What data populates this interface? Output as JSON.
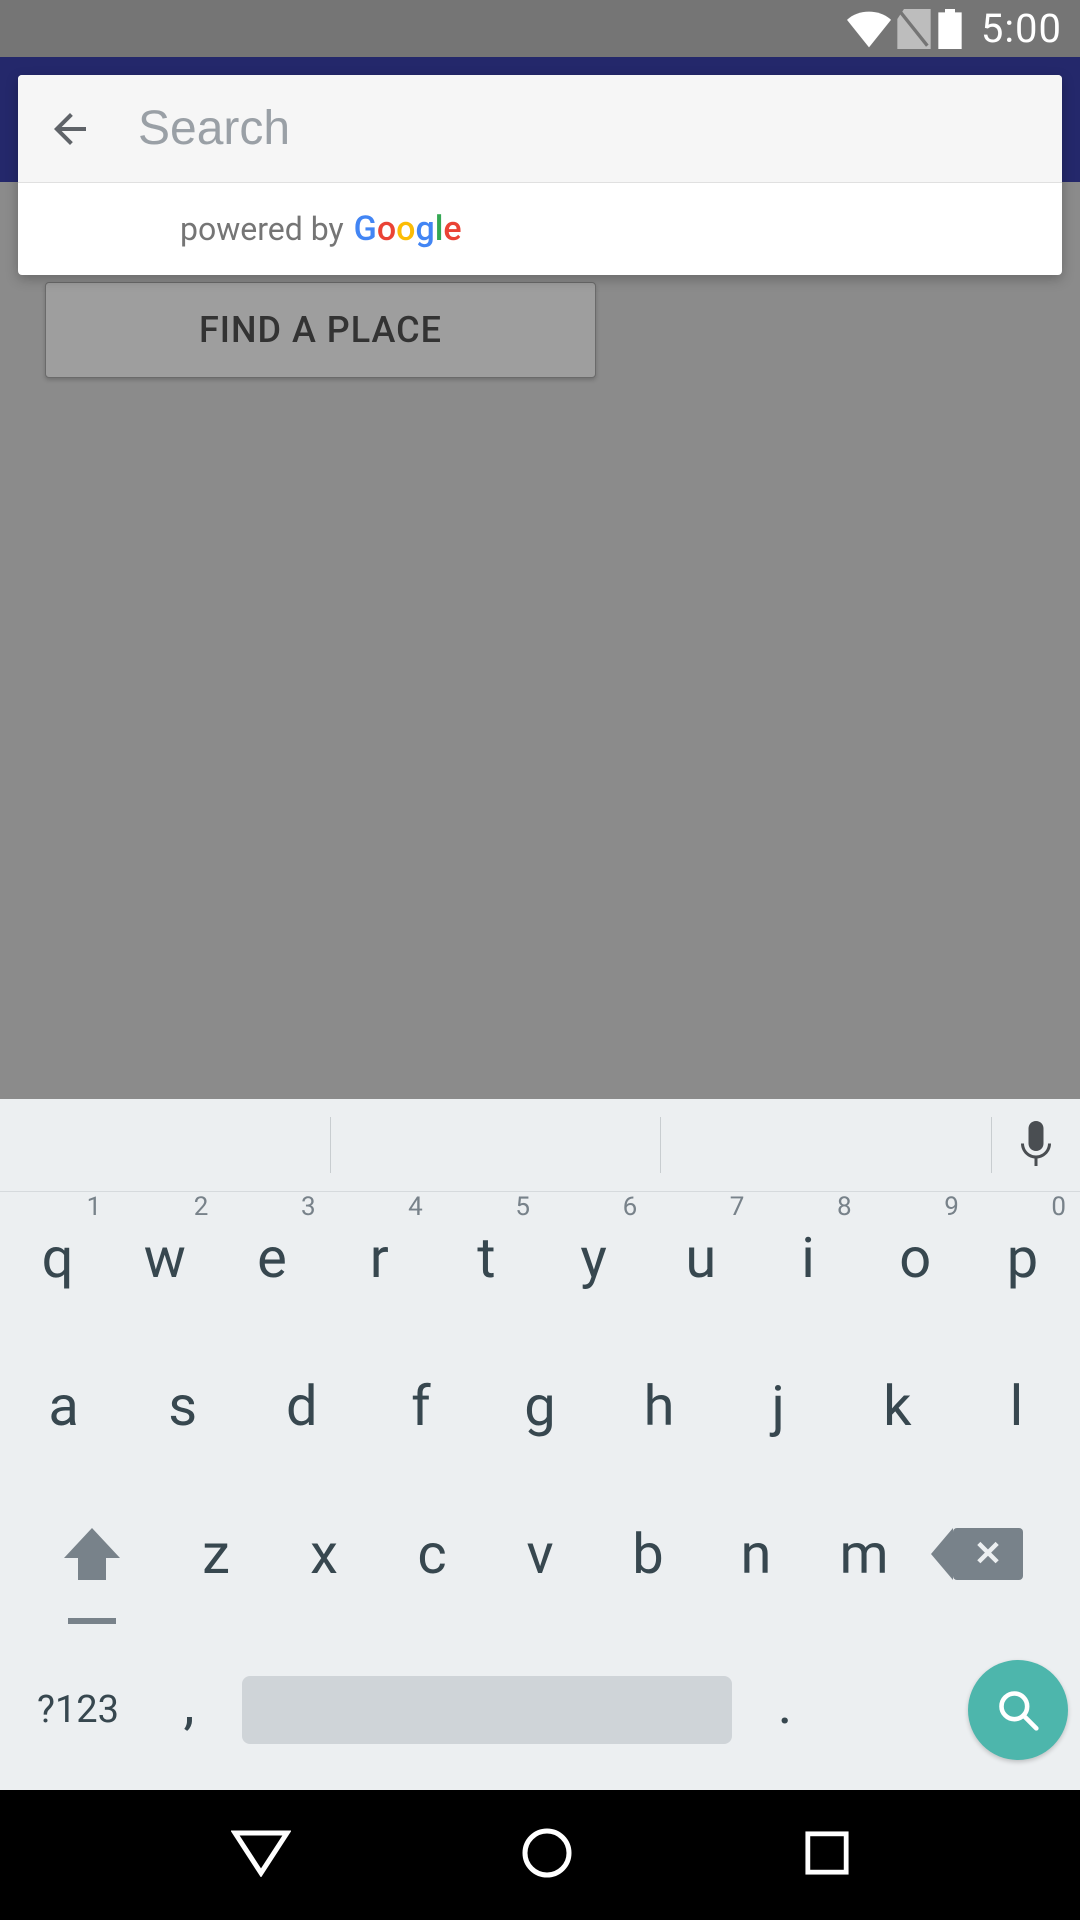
{
  "statusbar": {
    "time": "5:00"
  },
  "background": {
    "find_place_label": "FIND A PLACE"
  },
  "search": {
    "placeholder": "Search",
    "powered_by_text": "powered by",
    "google_letters": [
      "G",
      "o",
      "o",
      "g",
      "l",
      "e"
    ]
  },
  "keyboard": {
    "row1": [
      {
        "k": "q",
        "n": "1"
      },
      {
        "k": "w",
        "n": "2"
      },
      {
        "k": "e",
        "n": "3"
      },
      {
        "k": "r",
        "n": "4"
      },
      {
        "k": "t",
        "n": "5"
      },
      {
        "k": "y",
        "n": "6"
      },
      {
        "k": "u",
        "n": "7"
      },
      {
        "k": "i",
        "n": "8"
      },
      {
        "k": "o",
        "n": "9"
      },
      {
        "k": "p",
        "n": "0"
      }
    ],
    "row2": [
      "a",
      "s",
      "d",
      "f",
      "g",
      "h",
      "j",
      "k",
      "l"
    ],
    "row3": [
      "z",
      "x",
      "c",
      "v",
      "b",
      "n",
      "m"
    ],
    "symbols_label": "?123",
    "comma": ",",
    "period": "."
  }
}
